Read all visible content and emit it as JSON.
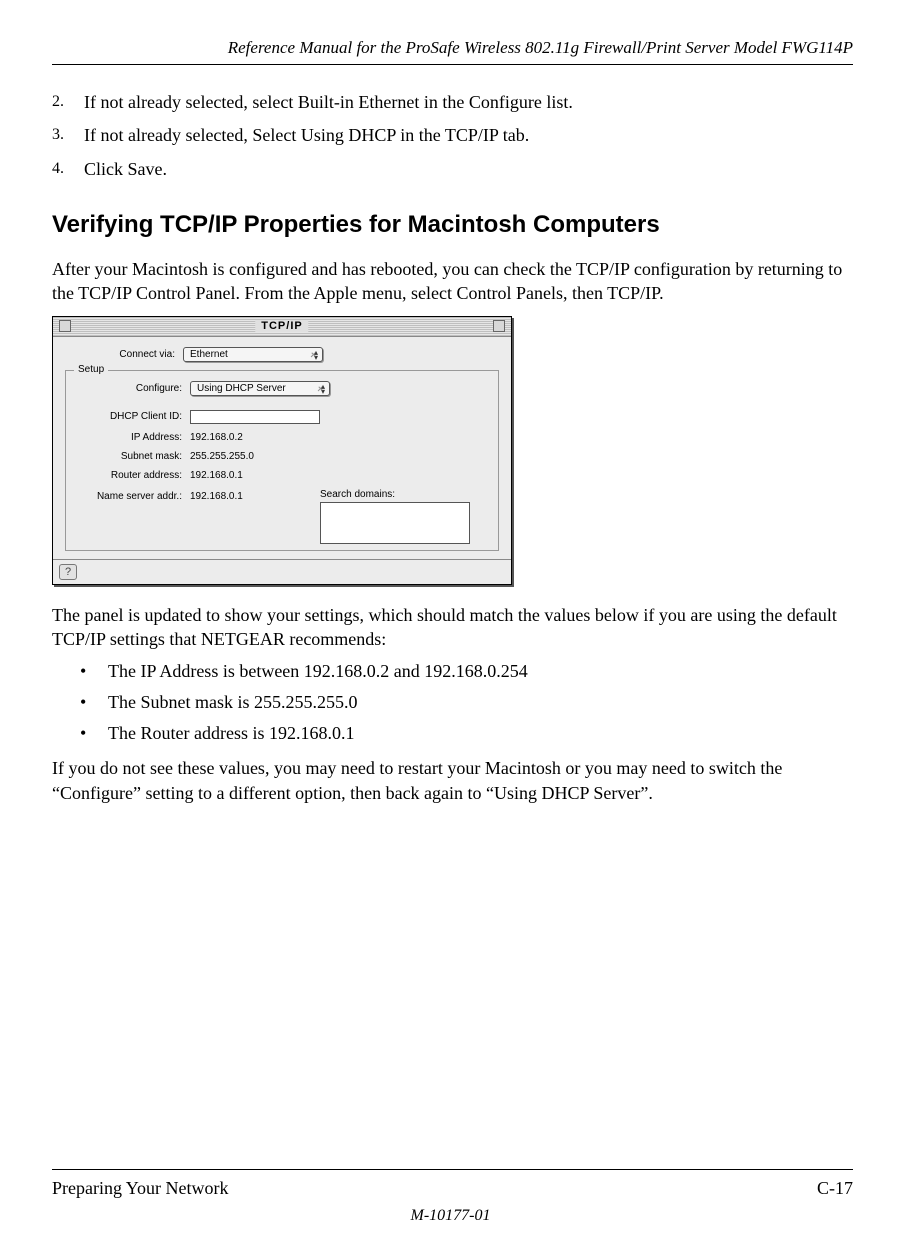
{
  "header": {
    "title": "Reference Manual for the ProSafe Wireless 802.11g  Firewall/Print Server Model FWG114P"
  },
  "steps": [
    {
      "num": "2.",
      "text": "If not already selected, select Built-in Ethernet in the Configure list."
    },
    {
      "num": "3.",
      "text": "If not already selected, Select Using DHCP in the TCP/IP tab."
    },
    {
      "num": "4.",
      "text": "Click Save."
    }
  ],
  "section_heading": "Verifying TCP/IP Properties for Macintosh Computers",
  "intro_para": "After your Macintosh is configured and has rebooted, you can check the TCP/IP configuration by returning to the TCP/IP Control Panel. From the Apple menu, select Control Panels, then TCP/IP.",
  "tcpip_panel": {
    "title": "TCP/IP",
    "connect_via_label": "Connect via:",
    "connect_via_value": "Ethernet",
    "setup_legend": "Setup",
    "configure_label": "Configure:",
    "configure_value": "Using DHCP Server",
    "dhcp_client_label": "DHCP Client ID:",
    "ip_address_label": "IP Address:",
    "ip_address_value": "192.168.0.2",
    "subnet_label": "Subnet mask:",
    "subnet_value": "255.255.255.0",
    "router_label": "Router address:",
    "router_value": "192.168.0.1",
    "ns_label": "Name server addr.:",
    "ns_value": "192.168.0.1",
    "search_label": "Search domains:",
    "help_icon": "?"
  },
  "post_panel_para": "The panel is updated to show your settings, which should match the values below if you are using the default TCP/IP settings that NETGEAR recommends:",
  "bullets": [
    "The IP Address is between 192.168.0.2 and 192.168.0.254",
    "The Subnet mask is 255.255.255.0",
    "The Router address is 192.168.0.1"
  ],
  "closing_para": "If you do not see these values, you may need to restart your Macintosh or you may need to switch the “Configure” setting to a different option, then back again to “Using DHCP Server”.",
  "footer": {
    "section": "Preparing Your Network",
    "page": "C-17",
    "doc_id": "M-10177-01"
  }
}
